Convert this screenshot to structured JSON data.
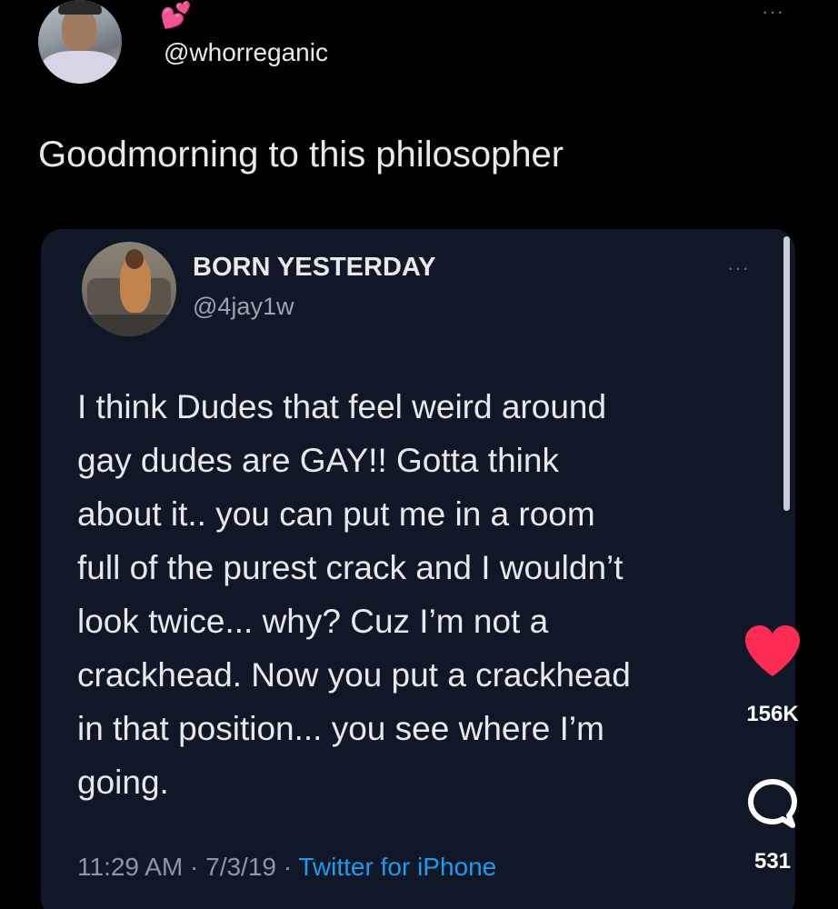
{
  "post": {
    "handle": "@whorreganic",
    "decoration_emoji": "💕",
    "text": "Goodmorning to this philosopher",
    "more_label": "···"
  },
  "quoted_tweet": {
    "display_name": "BORN YESTERDAY",
    "handle": "@4jay1w",
    "more_label": "···",
    "body_lines": [
      "I think Dudes that feel weird around",
      "gay dudes are GAY!! Gotta think",
      "about it.. you can put me  in a room",
      "full of the purest crack and I wouldn’t",
      "look twice... why? Cuz I’m not a",
      "crackhead. Now you put a crackhead",
      "in that position... you see where I’m",
      "going."
    ],
    "time": "11:29 AM",
    "date": "7/3/19",
    "separator": " · ",
    "source": "Twitter for iPhone"
  },
  "side_actions": {
    "like_count": "156K",
    "comment_count": "531",
    "like_icon": "heart-icon",
    "comment_icon": "comment-bubble-icon",
    "like_color": "#fe2c55"
  },
  "colors": {
    "background": "#000000",
    "card": "#101827",
    "link": "#1d9bf0",
    "muted": "#8b98a5"
  }
}
